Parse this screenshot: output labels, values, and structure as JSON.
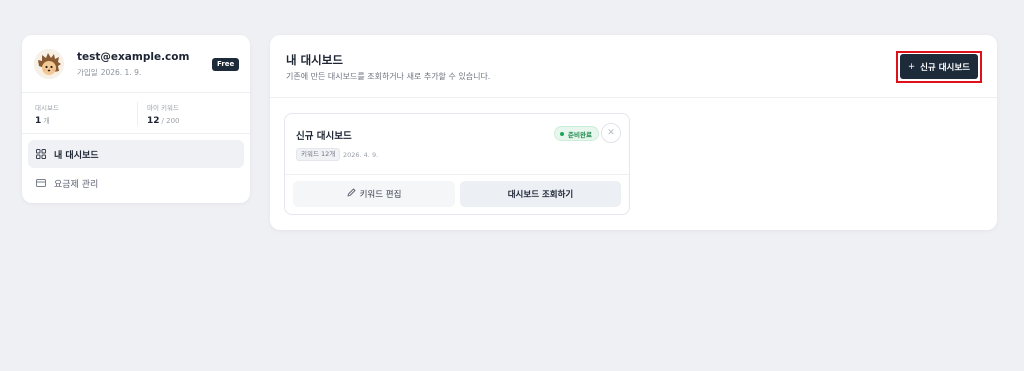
{
  "profile": {
    "email": "test@example.com",
    "joined_label": "가입일",
    "joined_date": "2026. 1. 9.",
    "plan_badge": "Free",
    "stats": {
      "dashboards_label": "대시보드",
      "dashboards_value": "1",
      "dashboards_unit": "개",
      "keywords_label": "마이 키워드",
      "keywords_value": "12",
      "keywords_limit": "/ 200"
    },
    "nav": [
      {
        "label": "내 대시보드",
        "icon": "grid-icon",
        "active": true
      },
      {
        "label": "요금제 관리",
        "icon": "billing-icon",
        "active": false
      }
    ]
  },
  "main": {
    "title": "내 대시보드",
    "subtitle": "기존에 만든 대시보드를 조회하거나 새로 추가할 수 있습니다.",
    "new_button": {
      "icon": "+",
      "label": "신규 대시보드"
    },
    "dashboards": [
      {
        "name": "신규 대시보드",
        "status": "준비완료",
        "keyword_tag": "키워드 12개",
        "date": "2026. 4. 9.",
        "edit_label": "키워드 편집",
        "view_label": "대시보드 조회하기"
      }
    ]
  },
  "colors": {
    "background": "#eff0f4",
    "primary_dark": "#1c2a3a",
    "status_green": "#22a55a",
    "highlight_red": "#e0101a"
  }
}
